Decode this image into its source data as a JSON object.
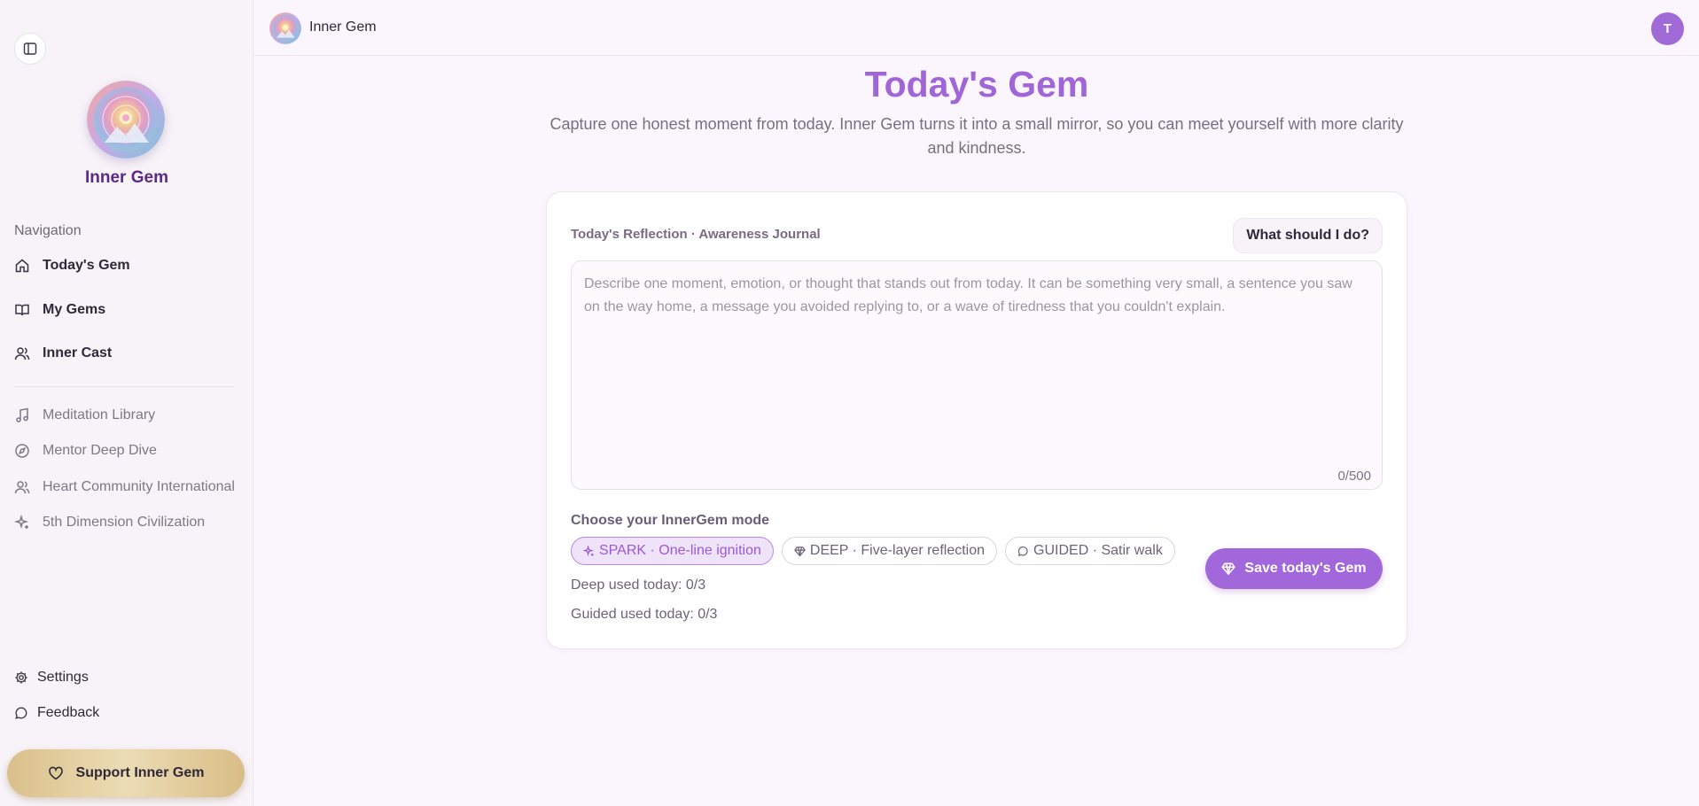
{
  "sidebar": {
    "brand_name": "Inner Gem",
    "nav_heading": "Navigation",
    "main_items": [
      {
        "label": "Today's Gem",
        "icon": "home-icon"
      },
      {
        "label": "My Gems",
        "icon": "book-icon"
      },
      {
        "label": "Inner Cast",
        "icon": "users-icon"
      }
    ],
    "sub_items": [
      {
        "label": "Meditation Library",
        "icon": "music-icon"
      },
      {
        "label": "Mentor Deep Dive",
        "icon": "compass-icon"
      },
      {
        "label": "Heart Community International",
        "icon": "users-icon"
      },
      {
        "label": "5th Dimension Civilization",
        "icon": "sparkle-icon"
      }
    ],
    "bottom_items": [
      {
        "label": "Settings",
        "icon": "gear-icon"
      },
      {
        "label": "Feedback",
        "icon": "chat-icon"
      }
    ],
    "support_label": "Support Inner Gem"
  },
  "topbar": {
    "title": "Inner Gem",
    "avatar_initial": "T"
  },
  "main": {
    "title": "Today's Gem",
    "subtitle": "Capture one honest moment from today. Inner Gem turns it into a small mirror, so you can meet yourself with more clarity and kindness."
  },
  "card": {
    "label": "Today's Reflection · Awareness Journal",
    "help_label": "What should I do?",
    "placeholder": "Describe one moment, emotion, or thought that stands out from today. It can be something very small, a sentence you saw on the way home, a message you avoided replying to, or a wave of tiredness that you couldn't explain.",
    "counter": "0/500",
    "mode_heading": "Choose your InnerGem mode",
    "modes": [
      {
        "label": "SPARK · One-line ignition",
        "icon": "sparkle-icon",
        "active": true
      },
      {
        "label": "DEEP · Five-layer reflection",
        "icon": "gem-icon",
        "active": false
      },
      {
        "label": "GUIDED · Satir walk",
        "icon": "chat-icon",
        "active": false
      }
    ],
    "deep_usage": "Deep used today: 0/3",
    "guided_usage": "Guided used today: 0/3",
    "save_label": "Save today's Gem"
  },
  "colors": {
    "accent": "#a267da",
    "title": "#a066d8",
    "brand": "#5b2a82",
    "support_gold": "#d9c08a"
  }
}
